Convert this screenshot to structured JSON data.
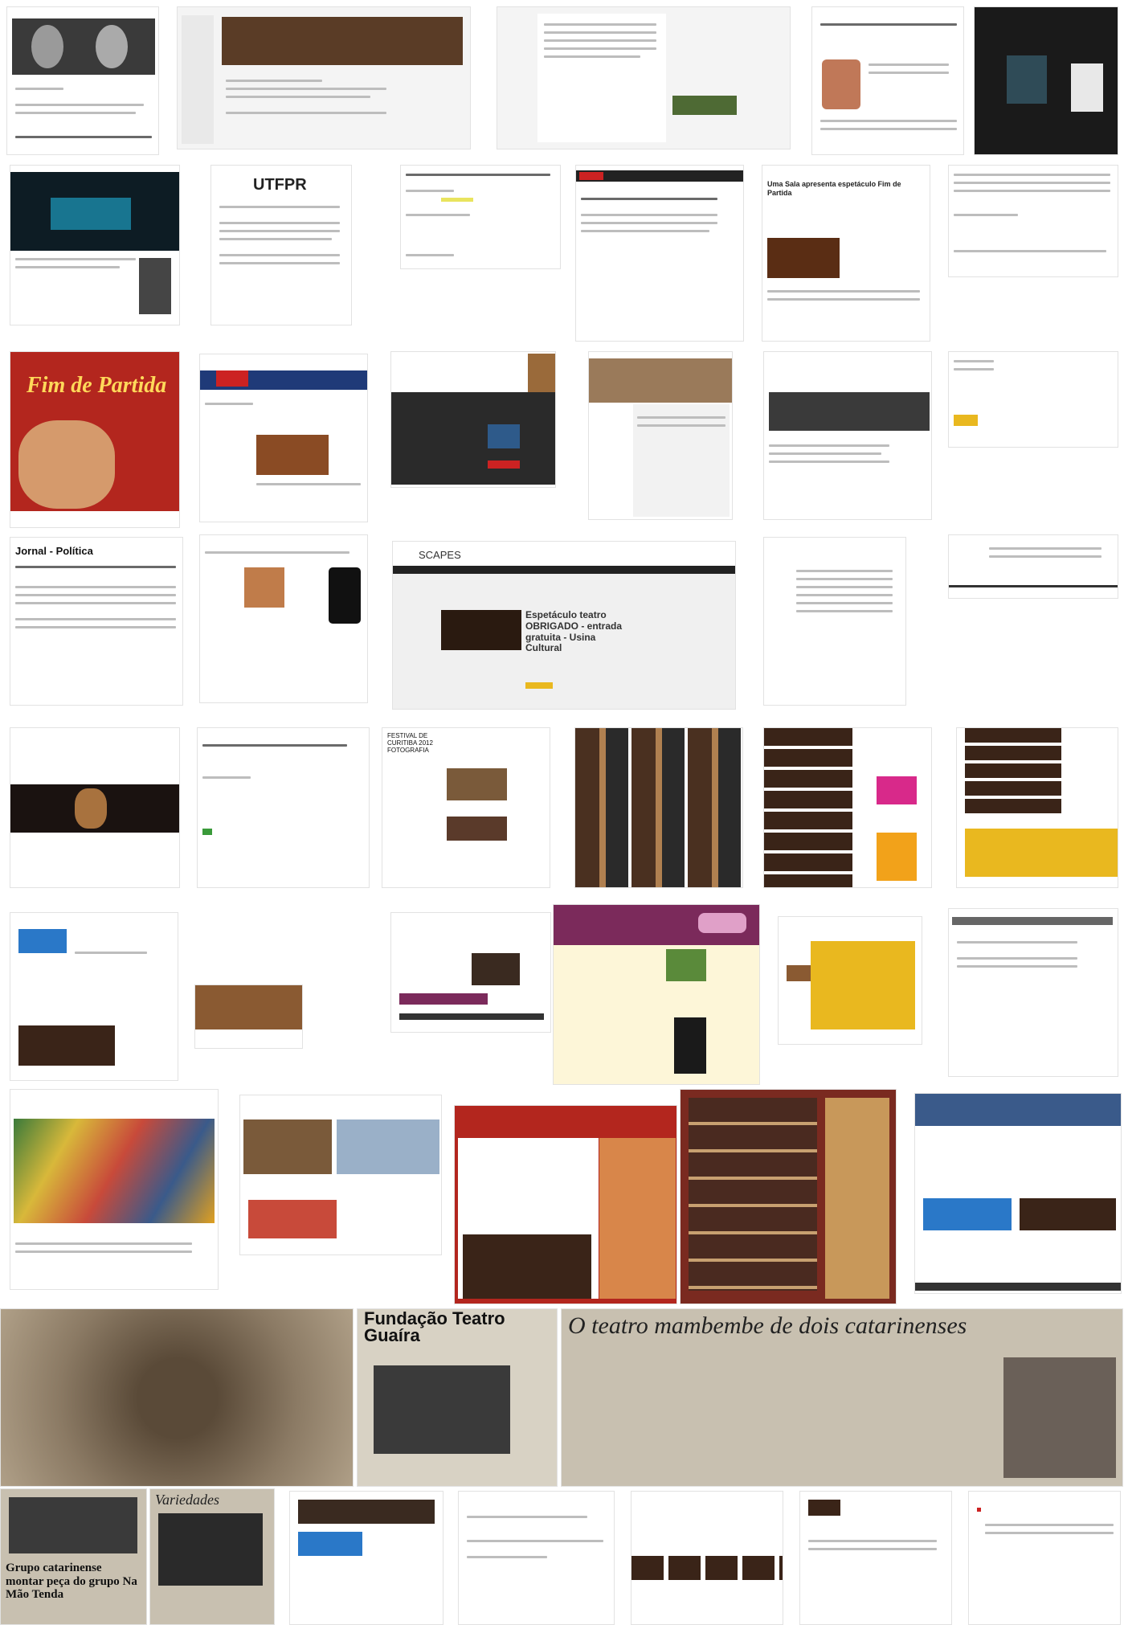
{
  "collage": {
    "tile_utfpr_logo": "UTFPR",
    "tile_poster_title": "Fim de Partida",
    "tile_jornal_heading": "Jornal - Política",
    "tile_scapes_brand": "SCAPES",
    "tile_scapes_headline": "Espetáculo teatro OBRIGADO - entrada gratuita - Usina Cultural",
    "tile_festival_title": "FESTIVAL DE CURITIBA 2012 FOTOGRAFIA",
    "tile_cia_header": "Uma Sala apresenta espetáculo Fim de Partida",
    "tile_fundacao": "Fundação Teatro Guaíra",
    "tile_newspaper_title": "O teatro mambembe de dois catarinenses",
    "tile_variedades": "Variedades",
    "tile_grupo_headline": "Grupo catarinense montar peça do grupo Na Mão Tenda"
  },
  "colors": {
    "dark_tile": "#1a1a1a",
    "red_poster": "#b3261e",
    "yellow_accent": "#e9b81f",
    "purple_header": "#7b2a5b",
    "sepia": "#8b7a64"
  }
}
